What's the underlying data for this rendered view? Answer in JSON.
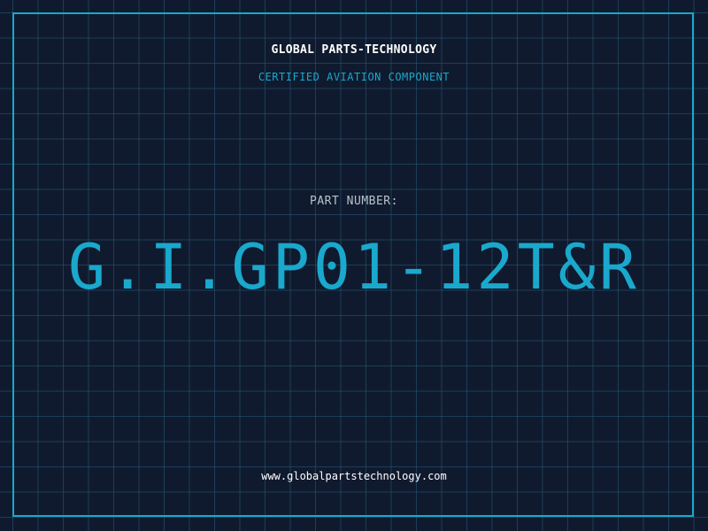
{
  "header": {
    "company_name": "GLOBAL PARTS-TECHNOLOGY",
    "tagline": "CERTIFIED AVIATION COMPONENT"
  },
  "part": {
    "label": "PART NUMBER:",
    "number": "G.I.GP01-12T&R"
  },
  "footer": {
    "website": "www.globalpartstechnology.com"
  },
  "colors": {
    "background": "#101a2e",
    "grid": "#265c76",
    "accent": "#1aa8cc",
    "text": "#ffffff",
    "muted_text": "#b8c2cc"
  }
}
